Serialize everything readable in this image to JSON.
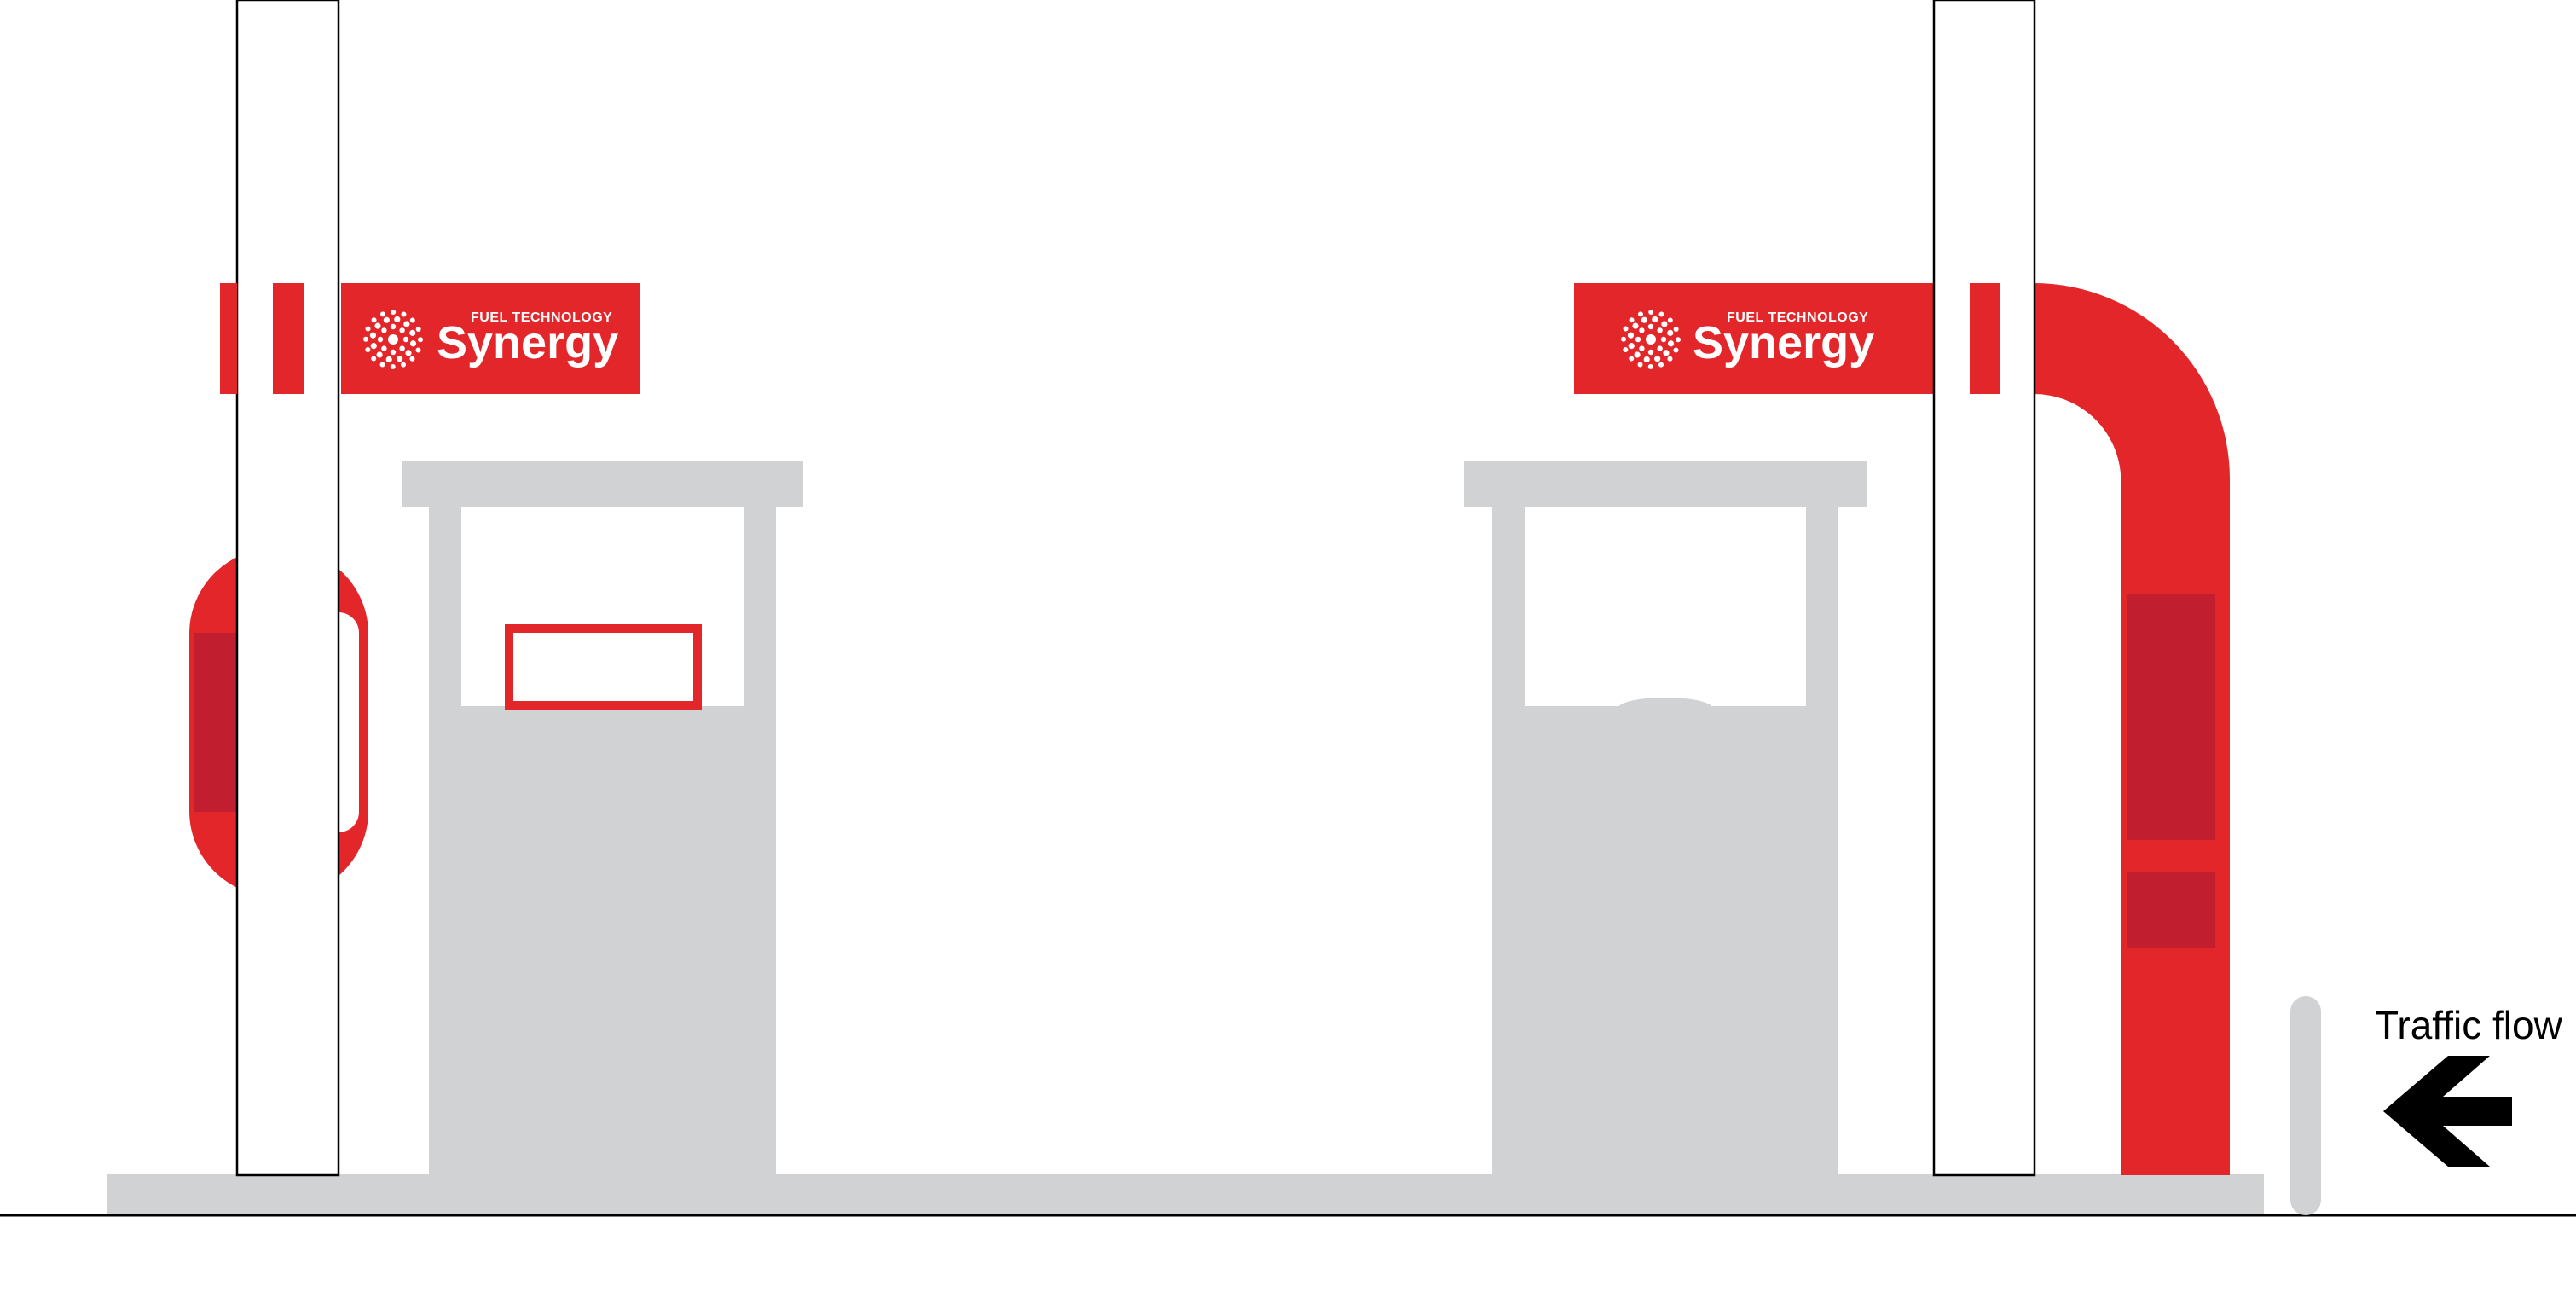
{
  "brand": {
    "small_text": "FUEL TECHNOLOGY",
    "name": "Synergy",
    "logo_icon": "sunburst-dots-icon"
  },
  "legend": {
    "traffic_label": "Traffic flow",
    "arrow_icon": "arrow-left-icon"
  },
  "colors": {
    "brand_red": "#e3262a",
    "dark_red": "#c11f2f",
    "grey": "#d1d2d4",
    "ground": "#000000"
  }
}
